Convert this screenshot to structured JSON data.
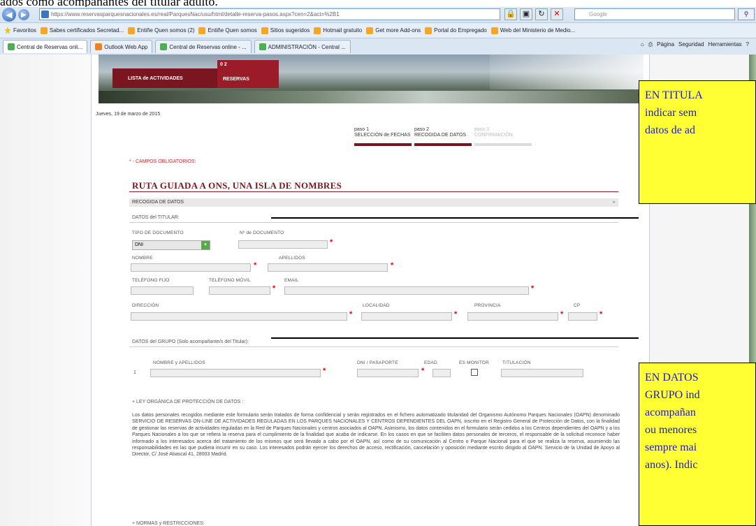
{
  "caption_top": "ados como acompañantes del titular adulto.",
  "browser": {
    "address": "https://www.reservasparquesnacionales.es/real/ParquesNac/usu/html/detalle-reserva-pasos.aspx?cen=2&act=%2B1",
    "address_host": "reservasparquesnacionales.es",
    "search_placeholder": "Google",
    "favorites_label": "Favoritos",
    "favorites": [
      "Sabes certificados Secretad...",
      "Entiñe Quen somos (2)",
      "Entiñe Quen somos",
      "Sitios sugeridos",
      "Hotmail gratuito",
      "Get more Add-ons",
      "Portal do Empregado",
      "Web del Ministerio de Medio..."
    ],
    "tabs": [
      "Central de Reservas onli...",
      "Outlook Web App",
      "Central de Reservas online - ...",
      "ADMINISTRACIÓN - Central ..."
    ],
    "tools": [
      "Página",
      "Seguridad",
      "Herramientas"
    ]
  },
  "site": {
    "menu_item_1": "LISTA de ACTIVIDADES",
    "menu_item_2_num": "0 2",
    "menu_item_2": "RESERVAS",
    "date": "Jueves, 19 de marzo de 2015",
    "steps": [
      {
        "num": "paso 1",
        "label": "SELECCIÓN de FECHAS"
      },
      {
        "num": "paso 2",
        "label": "RECOGIDA DE DATOS"
      },
      {
        "num": "paso 3",
        "label": "CONFIRMACIÓN"
      }
    ],
    "required_note": "* - CAMPOS OBLIGATORIOS:",
    "activity_title": "RUTA GUIADA A ONS, UNA ISLA DE NOMBRES",
    "section_recogida": "RECOGIDA DE DATOS",
    "section_titular": "DATOS del TITULAR:",
    "labels": {
      "tipo_doc": "TIPO DE DOCUMENTO",
      "num_doc": "Nº de DOCUMENTO",
      "nombre": "NOMBRE",
      "apellidos": "APELLIDOS",
      "tel_fijo": "TELÉFONO FIJO",
      "tel_movil": "TELÉFONO MÓVIL",
      "email": "EMAIL",
      "direccion": "DIRECCIÓN",
      "localidad": "LOCALIDAD",
      "provincia": "PROVINCIA",
      "cp": "CP"
    },
    "tipo_doc_value": "DNI",
    "section_grupo": "DATOS del GRUPO (Solo acompañante/s del Titular):",
    "group_headers": {
      "nombre": "NOMBRE y APELLIDOS",
      "dni": "DNI / PASAPORTE",
      "edad": "EDAD",
      "monitor": "ES MONITOR",
      "titulacion": "TITULACIÓN"
    },
    "group_row_num": "1",
    "lopd_title": "+ LEY ORGÁNICA DE PROTECCIÓN DE DATOS :",
    "lopd_text": "Los datos personales recogidos mediante este formulario serán tratados de forma confidencial y serán registrados en el fichero automatizado titularidad del Organismo Autónomo Parques Nacionales (OAPN) denominado SERVICIO DE RESERVAS ON-LINE DE ACTIVIDADES REGULADAS EN LOS PARQUES NACIONALES Y CENTROS DEPENDIENTES DEL OAPN, inscrito en el Registro General de Protección de Datos, con la finalidad de gestionar las reservas de actividades reguladas en la Red de Parques Nacionales y centros asociados al OAPN. Asimismo, los datos contenidos en el formulario serán cedidos a los Centros dependientes del OAPN y a los Parques Nacionales a los que se refiera la reserva para el cumplimiento de la finalidad que acaba de indicarse. En los casos en que se faciliten datos personales de terceros, el responsable de la solicitud reconoce haber informado a los interesados acerca del tratamiento de los mismos que será llevado a cabo por el OAPN, así como de su comunicación al Centro o Parque Nacional para el que se realiza la reserva, asumiendo las responsabilidades en las que pudiera incurrir en su caso. Los interesados podrán ejercer los derechos de acceso, rectificación, cancelación y oposición mediante escrito dirigido al OAPN. Servicio de la Unidad de Apoyo al Director, C/ José Abascal 41, 28003 Madrid.",
    "normas_title": "+ NORMAS y RESTRICCIONES:"
  },
  "notes": {
    "note1_lines": [
      "EN TITULA",
      "indicar sem",
      "datos de ad"
    ],
    "note2_lines": [
      "EN DATOS",
      "GRUPO ind",
      "acompañan",
      "ou menores",
      "sempre mai",
      "anos). Indic"
    ]
  },
  "colors": {
    "brand": "#7a1620",
    "note_bg": "#ffff33",
    "note_text": "#1a1ad0",
    "required": "#ee0000"
  }
}
